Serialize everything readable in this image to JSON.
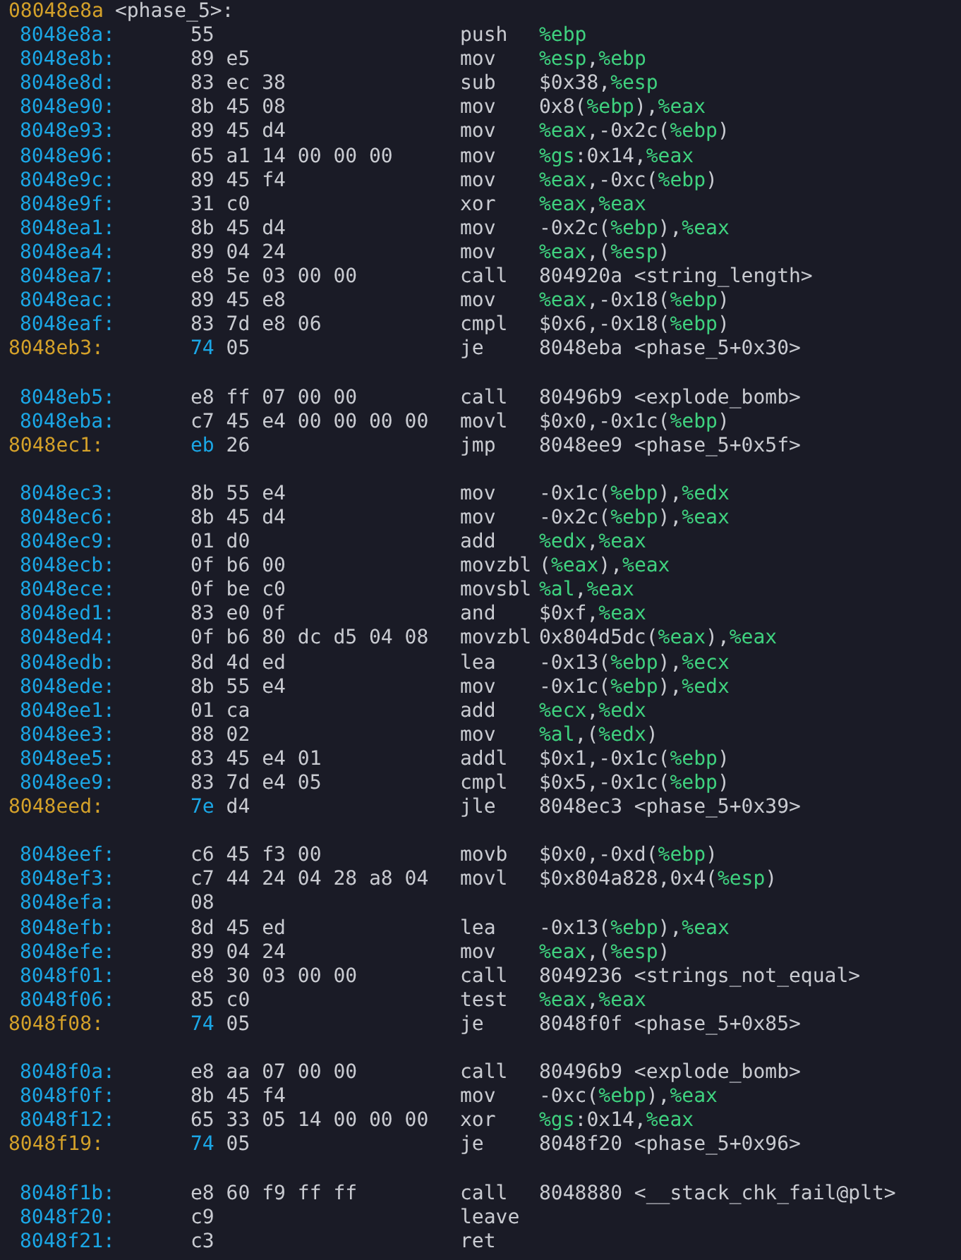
{
  "listing": [
    {
      "kind": "label",
      "address": "08048e8a",
      "symbol": "<phase_5>:"
    },
    {
      "kind": "instr",
      "address": "8048e8a:",
      "bytes": [
        "55"
      ],
      "mnemonic": "push",
      "ops": [
        {
          "text": "%ebp",
          "kind": "reg"
        }
      ]
    },
    {
      "kind": "instr",
      "address": "8048e8b:",
      "bytes": [
        "89",
        "e5"
      ],
      "mnemonic": "mov",
      "ops": [
        {
          "text": "%esp",
          "kind": "reg"
        },
        {
          "text": ",",
          "kind": "plain"
        },
        {
          "text": "%ebp",
          "kind": "reg"
        }
      ]
    },
    {
      "kind": "instr",
      "address": "8048e8d:",
      "bytes": [
        "83",
        "ec",
        "38"
      ],
      "mnemonic": "sub",
      "ops": [
        {
          "text": "$0x38,",
          "kind": "plain"
        },
        {
          "text": "%esp",
          "kind": "reg"
        }
      ]
    },
    {
      "kind": "instr",
      "address": "8048e90:",
      "bytes": [
        "8b",
        "45",
        "08"
      ],
      "mnemonic": "mov",
      "ops": [
        {
          "text": "0x8(",
          "kind": "plain"
        },
        {
          "text": "%ebp",
          "kind": "reg"
        },
        {
          "text": "),",
          "kind": "plain"
        },
        {
          "text": "%eax",
          "kind": "reg"
        }
      ]
    },
    {
      "kind": "instr",
      "address": "8048e93:",
      "bytes": [
        "89",
        "45",
        "d4"
      ],
      "mnemonic": "mov",
      "ops": [
        {
          "text": "%eax",
          "kind": "reg"
        },
        {
          "text": ",-0x2c(",
          "kind": "plain"
        },
        {
          "text": "%ebp",
          "kind": "reg"
        },
        {
          "text": ")",
          "kind": "plain"
        }
      ]
    },
    {
      "kind": "instr",
      "address": "8048e96:",
      "bytes": [
        "65",
        "a1",
        "14",
        "00",
        "00",
        "00"
      ],
      "mnemonic": "mov",
      "ops": [
        {
          "text": "%gs",
          "kind": "reg"
        },
        {
          "text": ":0x14,",
          "kind": "plain"
        },
        {
          "text": "%eax",
          "kind": "reg"
        }
      ]
    },
    {
      "kind": "instr",
      "address": "8048e9c:",
      "bytes": [
        "89",
        "45",
        "f4"
      ],
      "mnemonic": "mov",
      "ops": [
        {
          "text": "%eax",
          "kind": "reg"
        },
        {
          "text": ",-0xc(",
          "kind": "plain"
        },
        {
          "text": "%ebp",
          "kind": "reg"
        },
        {
          "text": ")",
          "kind": "plain"
        }
      ]
    },
    {
      "kind": "instr",
      "address": "8048e9f:",
      "bytes": [
        "31",
        "c0"
      ],
      "mnemonic": "xor",
      "ops": [
        {
          "text": "%eax",
          "kind": "reg"
        },
        {
          "text": ",",
          "kind": "plain"
        },
        {
          "text": "%eax",
          "kind": "reg"
        }
      ]
    },
    {
      "kind": "instr",
      "address": "8048ea1:",
      "bytes": [
        "8b",
        "45",
        "d4"
      ],
      "mnemonic": "mov",
      "ops": [
        {
          "text": "-0x2c(",
          "kind": "plain"
        },
        {
          "text": "%ebp",
          "kind": "reg"
        },
        {
          "text": "),",
          "kind": "plain"
        },
        {
          "text": "%eax",
          "kind": "reg"
        }
      ]
    },
    {
      "kind": "instr",
      "address": "8048ea4:",
      "bytes": [
        "89",
        "04",
        "24"
      ],
      "mnemonic": "mov",
      "ops": [
        {
          "text": "%eax",
          "kind": "reg"
        },
        {
          "text": ",(",
          "kind": "plain"
        },
        {
          "text": "%esp",
          "kind": "reg"
        },
        {
          "text": ")",
          "kind": "plain"
        }
      ]
    },
    {
      "kind": "instr",
      "address": "8048ea7:",
      "bytes": [
        "e8",
        "5e",
        "03",
        "00",
        "00"
      ],
      "mnemonic": "call",
      "ops": [
        {
          "text": "804920a <string_length>",
          "kind": "plain"
        }
      ]
    },
    {
      "kind": "instr",
      "address": "8048eac:",
      "bytes": [
        "89",
        "45",
        "e8"
      ],
      "mnemonic": "mov",
      "ops": [
        {
          "text": "%eax",
          "kind": "reg"
        },
        {
          "text": ",-0x18(",
          "kind": "plain"
        },
        {
          "text": "%ebp",
          "kind": "reg"
        },
        {
          "text": ")",
          "kind": "plain"
        }
      ]
    },
    {
      "kind": "instr",
      "address": "8048eaf:",
      "bytes": [
        "83",
        "7d",
        "e8",
        "06"
      ],
      "mnemonic": "cmpl",
      "ops": [
        {
          "text": "$0x6,-0x18(",
          "kind": "plain"
        },
        {
          "text": "%ebp",
          "kind": "reg"
        },
        {
          "text": ")",
          "kind": "plain"
        }
      ]
    },
    {
      "kind": "branch",
      "address": "8048eb3:",
      "bytes": [
        "74",
        "05"
      ],
      "mnemonic": "je",
      "ops": [
        {
          "text": "8048eba <phase_5+0x30>",
          "kind": "plain"
        }
      ]
    },
    {
      "kind": "blank"
    },
    {
      "kind": "instr",
      "address": "8048eb5:",
      "bytes": [
        "e8",
        "ff",
        "07",
        "00",
        "00"
      ],
      "mnemonic": "call",
      "ops": [
        {
          "text": "80496b9 <explode_bomb>",
          "kind": "plain"
        }
      ]
    },
    {
      "kind": "instr",
      "address": "8048eba:",
      "bytes": [
        "c7",
        "45",
        "e4",
        "00",
        "00",
        "00",
        "00"
      ],
      "mnemonic": "movl",
      "ops": [
        {
          "text": "$0x0,-0x1c(",
          "kind": "plain"
        },
        {
          "text": "%ebp",
          "kind": "reg"
        },
        {
          "text": ")",
          "kind": "plain"
        }
      ]
    },
    {
      "kind": "branch",
      "address": "8048ec1:",
      "bytes": [
        "eb",
        "26"
      ],
      "mnemonic": "jmp",
      "ops": [
        {
          "text": "8048ee9 <phase_5+0x5f>",
          "kind": "plain"
        }
      ]
    },
    {
      "kind": "blank"
    },
    {
      "kind": "instr",
      "address": "8048ec3:",
      "bytes": [
        "8b",
        "55",
        "e4"
      ],
      "mnemonic": "mov",
      "ops": [
        {
          "text": "-0x1c(",
          "kind": "plain"
        },
        {
          "text": "%ebp",
          "kind": "reg"
        },
        {
          "text": "),",
          "kind": "plain"
        },
        {
          "text": "%edx",
          "kind": "reg"
        }
      ]
    },
    {
      "kind": "instr",
      "address": "8048ec6:",
      "bytes": [
        "8b",
        "45",
        "d4"
      ],
      "mnemonic": "mov",
      "ops": [
        {
          "text": "-0x2c(",
          "kind": "plain"
        },
        {
          "text": "%ebp",
          "kind": "reg"
        },
        {
          "text": "),",
          "kind": "plain"
        },
        {
          "text": "%eax",
          "kind": "reg"
        }
      ]
    },
    {
      "kind": "instr",
      "address": "8048ec9:",
      "bytes": [
        "01",
        "d0"
      ],
      "mnemonic": "add",
      "ops": [
        {
          "text": "%edx",
          "kind": "reg"
        },
        {
          "text": ",",
          "kind": "plain"
        },
        {
          "text": "%eax",
          "kind": "reg"
        }
      ]
    },
    {
      "kind": "instr",
      "address": "8048ecb:",
      "bytes": [
        "0f",
        "b6",
        "00"
      ],
      "mnemonic": "movzbl",
      "ops": [
        {
          "text": "(",
          "kind": "plain"
        },
        {
          "text": "%eax",
          "kind": "reg"
        },
        {
          "text": "),",
          "kind": "plain"
        },
        {
          "text": "%eax",
          "kind": "reg"
        }
      ]
    },
    {
      "kind": "instr",
      "address": "8048ece:",
      "bytes": [
        "0f",
        "be",
        "c0"
      ],
      "mnemonic": "movsbl",
      "ops": [
        {
          "text": "%al",
          "kind": "reg"
        },
        {
          "text": ",",
          "kind": "plain"
        },
        {
          "text": "%eax",
          "kind": "reg"
        }
      ]
    },
    {
      "kind": "instr",
      "address": "8048ed1:",
      "bytes": [
        "83",
        "e0",
        "0f"
      ],
      "mnemonic": "and",
      "ops": [
        {
          "text": "$0xf,",
          "kind": "plain"
        },
        {
          "text": "%eax",
          "kind": "reg"
        }
      ]
    },
    {
      "kind": "instr",
      "address": "8048ed4:",
      "bytes": [
        "0f",
        "b6",
        "80",
        "dc",
        "d5",
        "04",
        "08"
      ],
      "mnemonic": "movzbl",
      "ops": [
        {
          "text": "0x804d5dc(",
          "kind": "plain"
        },
        {
          "text": "%eax",
          "kind": "reg"
        },
        {
          "text": "),",
          "kind": "plain"
        },
        {
          "text": "%eax",
          "kind": "reg"
        }
      ]
    },
    {
      "kind": "instr",
      "address": "8048edb:",
      "bytes": [
        "8d",
        "4d",
        "ed"
      ],
      "mnemonic": "lea",
      "ops": [
        {
          "text": "-0x13(",
          "kind": "plain"
        },
        {
          "text": "%ebp",
          "kind": "reg"
        },
        {
          "text": "),",
          "kind": "plain"
        },
        {
          "text": "%ecx",
          "kind": "reg"
        }
      ]
    },
    {
      "kind": "instr",
      "address": "8048ede:",
      "bytes": [
        "8b",
        "55",
        "e4"
      ],
      "mnemonic": "mov",
      "ops": [
        {
          "text": "-0x1c(",
          "kind": "plain"
        },
        {
          "text": "%ebp",
          "kind": "reg"
        },
        {
          "text": "),",
          "kind": "plain"
        },
        {
          "text": "%edx",
          "kind": "reg"
        }
      ]
    },
    {
      "kind": "instr",
      "address": "8048ee1:",
      "bytes": [
        "01",
        "ca"
      ],
      "mnemonic": "add",
      "ops": [
        {
          "text": "%ecx",
          "kind": "reg"
        },
        {
          "text": ",",
          "kind": "plain"
        },
        {
          "text": "%edx",
          "kind": "reg"
        }
      ]
    },
    {
      "kind": "instr",
      "address": "8048ee3:",
      "bytes": [
        "88",
        "02"
      ],
      "mnemonic": "mov",
      "ops": [
        {
          "text": "%al",
          "kind": "reg"
        },
        {
          "text": ",(",
          "kind": "plain"
        },
        {
          "text": "%edx",
          "kind": "reg"
        },
        {
          "text": ")",
          "kind": "plain"
        }
      ]
    },
    {
      "kind": "instr",
      "address": "8048ee5:",
      "bytes": [
        "83",
        "45",
        "e4",
        "01"
      ],
      "mnemonic": "addl",
      "ops": [
        {
          "text": "$0x1,-0x1c(",
          "kind": "plain"
        },
        {
          "text": "%ebp",
          "kind": "reg"
        },
        {
          "text": ")",
          "kind": "plain"
        }
      ]
    },
    {
      "kind": "instr",
      "address": "8048ee9:",
      "bytes": [
        "83",
        "7d",
        "e4",
        "05"
      ],
      "mnemonic": "cmpl",
      "ops": [
        {
          "text": "$0x5,-0x1c(",
          "kind": "plain"
        },
        {
          "text": "%ebp",
          "kind": "reg"
        },
        {
          "text": ")",
          "kind": "plain"
        }
      ]
    },
    {
      "kind": "branch",
      "address": "8048eed:",
      "bytes": [
        "7e",
        "d4"
      ],
      "mnemonic": "jle",
      "ops": [
        {
          "text": "8048ec3 <phase_5+0x39>",
          "kind": "plain"
        }
      ]
    },
    {
      "kind": "blank"
    },
    {
      "kind": "instr",
      "address": "8048eef:",
      "bytes": [
        "c6",
        "45",
        "f3",
        "00"
      ],
      "mnemonic": "movb",
      "ops": [
        {
          "text": "$0x0,-0xd(",
          "kind": "plain"
        },
        {
          "text": "%ebp",
          "kind": "reg"
        },
        {
          "text": ")",
          "kind": "plain"
        }
      ]
    },
    {
      "kind": "instr",
      "address": "8048ef3:",
      "bytes": [
        "c7",
        "44",
        "24",
        "04",
        "28",
        "a8",
        "04"
      ],
      "mnemonic": "movl",
      "ops": [
        {
          "text": "$0x804a828,0x4(",
          "kind": "plain"
        },
        {
          "text": "%esp",
          "kind": "reg"
        },
        {
          "text": ")",
          "kind": "plain"
        }
      ]
    },
    {
      "kind": "instr",
      "address": "8048efa:",
      "bytes": [
        "08"
      ]
    },
    {
      "kind": "instr",
      "address": "8048efb:",
      "bytes": [
        "8d",
        "45",
        "ed"
      ],
      "mnemonic": "lea",
      "ops": [
        {
          "text": "-0x13(",
          "kind": "plain"
        },
        {
          "text": "%ebp",
          "kind": "reg"
        },
        {
          "text": "),",
          "kind": "plain"
        },
        {
          "text": "%eax",
          "kind": "reg"
        }
      ]
    },
    {
      "kind": "instr",
      "address": "8048efe:",
      "bytes": [
        "89",
        "04",
        "24"
      ],
      "mnemonic": "mov",
      "ops": [
        {
          "text": "%eax",
          "kind": "reg"
        },
        {
          "text": ",(",
          "kind": "plain"
        },
        {
          "text": "%esp",
          "kind": "reg"
        },
        {
          "text": ")",
          "kind": "plain"
        }
      ]
    },
    {
      "kind": "instr",
      "address": "8048f01:",
      "bytes": [
        "e8",
        "30",
        "03",
        "00",
        "00"
      ],
      "mnemonic": "call",
      "ops": [
        {
          "text": "8049236 <strings_not_equal>",
          "kind": "plain"
        }
      ]
    },
    {
      "kind": "instr",
      "address": "8048f06:",
      "bytes": [
        "85",
        "c0"
      ],
      "mnemonic": "test",
      "ops": [
        {
          "text": "%eax",
          "kind": "reg"
        },
        {
          "text": ",",
          "kind": "plain"
        },
        {
          "text": "%eax",
          "kind": "reg"
        }
      ]
    },
    {
      "kind": "branch",
      "address": "8048f08:",
      "bytes": [
        "74",
        "05"
      ],
      "mnemonic": "je",
      "ops": [
        {
          "text": "8048f0f <phase_5+0x85>",
          "kind": "plain"
        }
      ]
    },
    {
      "kind": "blank"
    },
    {
      "kind": "instr",
      "address": "8048f0a:",
      "bytes": [
        "e8",
        "aa",
        "07",
        "00",
        "00"
      ],
      "mnemonic": "call",
      "ops": [
        {
          "text": "80496b9 <explode_bomb>",
          "kind": "plain"
        }
      ]
    },
    {
      "kind": "instr",
      "address": "8048f0f:",
      "bytes": [
        "8b",
        "45",
        "f4"
      ],
      "mnemonic": "mov",
      "ops": [
        {
          "text": "-0xc(",
          "kind": "plain"
        },
        {
          "text": "%ebp",
          "kind": "reg"
        },
        {
          "text": "),",
          "kind": "plain"
        },
        {
          "text": "%eax",
          "kind": "reg"
        }
      ]
    },
    {
      "kind": "instr",
      "address": "8048f12:",
      "bytes": [
        "65",
        "33",
        "05",
        "14",
        "00",
        "00",
        "00"
      ],
      "mnemonic": "xor",
      "ops": [
        {
          "text": "%gs",
          "kind": "reg"
        },
        {
          "text": ":0x14,",
          "kind": "plain"
        },
        {
          "text": "%eax",
          "kind": "reg"
        }
      ]
    },
    {
      "kind": "branch",
      "address": "8048f19:",
      "bytes": [
        "74",
        "05"
      ],
      "mnemonic": "je",
      "ops": [
        {
          "text": "8048f20 <phase_5+0x96>",
          "kind": "plain"
        }
      ]
    },
    {
      "kind": "blank"
    },
    {
      "kind": "instr",
      "address": "8048f1b:",
      "bytes": [
        "e8",
        "60",
        "f9",
        "ff",
        "ff"
      ],
      "mnemonic": "call",
      "ops": [
        {
          "text": "8048880 <__stack_chk_fail@plt>",
          "kind": "plain"
        }
      ]
    },
    {
      "kind": "instr",
      "address": "8048f20:",
      "bytes": [
        "c9"
      ],
      "mnemonic": "leave"
    },
    {
      "kind": "instr",
      "address": "8048f21:",
      "bytes": [
        "c3"
      ],
      "mnemonic": "ret"
    }
  ]
}
